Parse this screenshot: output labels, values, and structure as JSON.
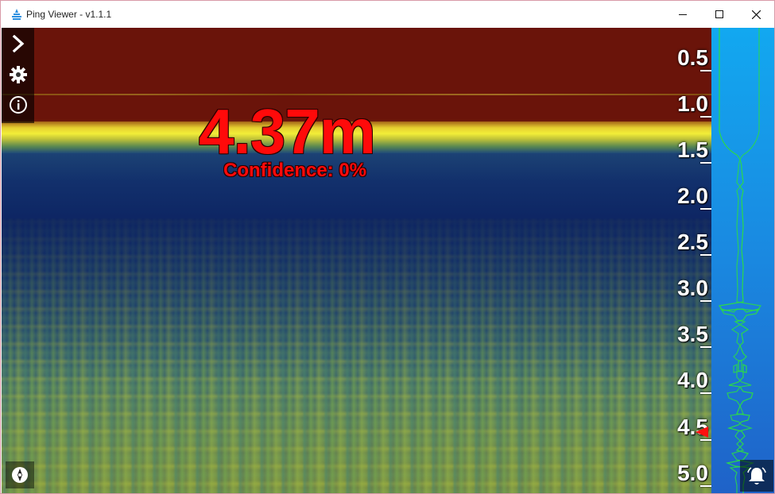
{
  "window": {
    "title": "Ping Viewer - v1.1.1",
    "controls": {
      "minimize": "minimize-icon",
      "maximize": "maximize-icon",
      "close": "close-icon"
    }
  },
  "sidebar": {
    "items": [
      {
        "name": "expand",
        "icon": "chevron-right-icon"
      },
      {
        "name": "settings",
        "icon": "gear-icon"
      },
      {
        "name": "info",
        "icon": "info-icon"
      }
    ]
  },
  "readout": {
    "distance": "4.37m",
    "confidence": "Confidence: 0%"
  },
  "scale": {
    "ticks": [
      "0.5",
      "1.0",
      "1.5",
      "2.0",
      "2.5",
      "3.0",
      "3.5",
      "4.0",
      "4.5",
      "5.0"
    ]
  },
  "colors": {
    "readout": "#ff0a0a",
    "profile_line": "#2bd94a",
    "surface": "#6a140a",
    "echo": "#f2ee38",
    "water": "#0c2260"
  },
  "buttons": {
    "bottom_left": "compass-icon",
    "bottom_right": "bell-icon"
  }
}
